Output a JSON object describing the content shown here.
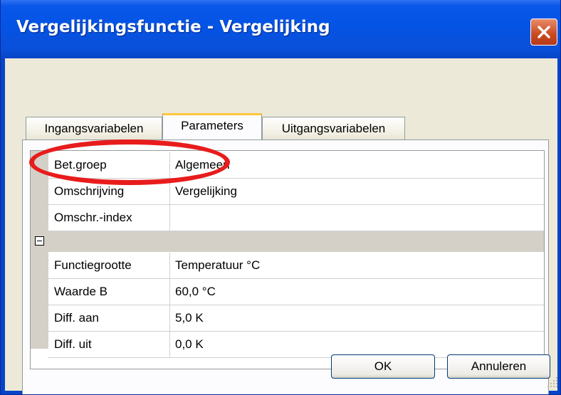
{
  "window": {
    "title": "Vergelijkingsfunctie - Vergelijking",
    "close_icon": "close-x-icon"
  },
  "tabs": [
    {
      "label": "Ingangsvariabelen",
      "active": false
    },
    {
      "label": "Parameters",
      "active": true
    },
    {
      "label": "Uitgangsvariabelen",
      "active": false
    }
  ],
  "properties": {
    "group1": [
      {
        "label": "Bet.groep",
        "value": "Algemeen"
      },
      {
        "label": "Omschrijving",
        "value": "Vergelijking"
      },
      {
        "label": "Omschr.-index",
        "value": ""
      }
    ],
    "category_icon": "collapse-minus-icon",
    "group2": [
      {
        "label": "Functiegrootte",
        "value": "Temperatuur °C"
      },
      {
        "label": "Waarde B",
        "value": "60,0 °C"
      },
      {
        "label": "Diff. aan",
        "value": "5,0 K"
      },
      {
        "label": "Diff. uit",
        "value": "0,0 K"
      }
    ]
  },
  "annotation": {
    "color": "#e81c1c"
  },
  "buttons": {
    "ok": "OK",
    "cancel": "Annuleren"
  },
  "colors": {
    "titlebar": "#0454e6",
    "window_body": "#ece9d8",
    "active_tab_accent": "#ffc83c",
    "gutter": "#d4d0c8"
  }
}
